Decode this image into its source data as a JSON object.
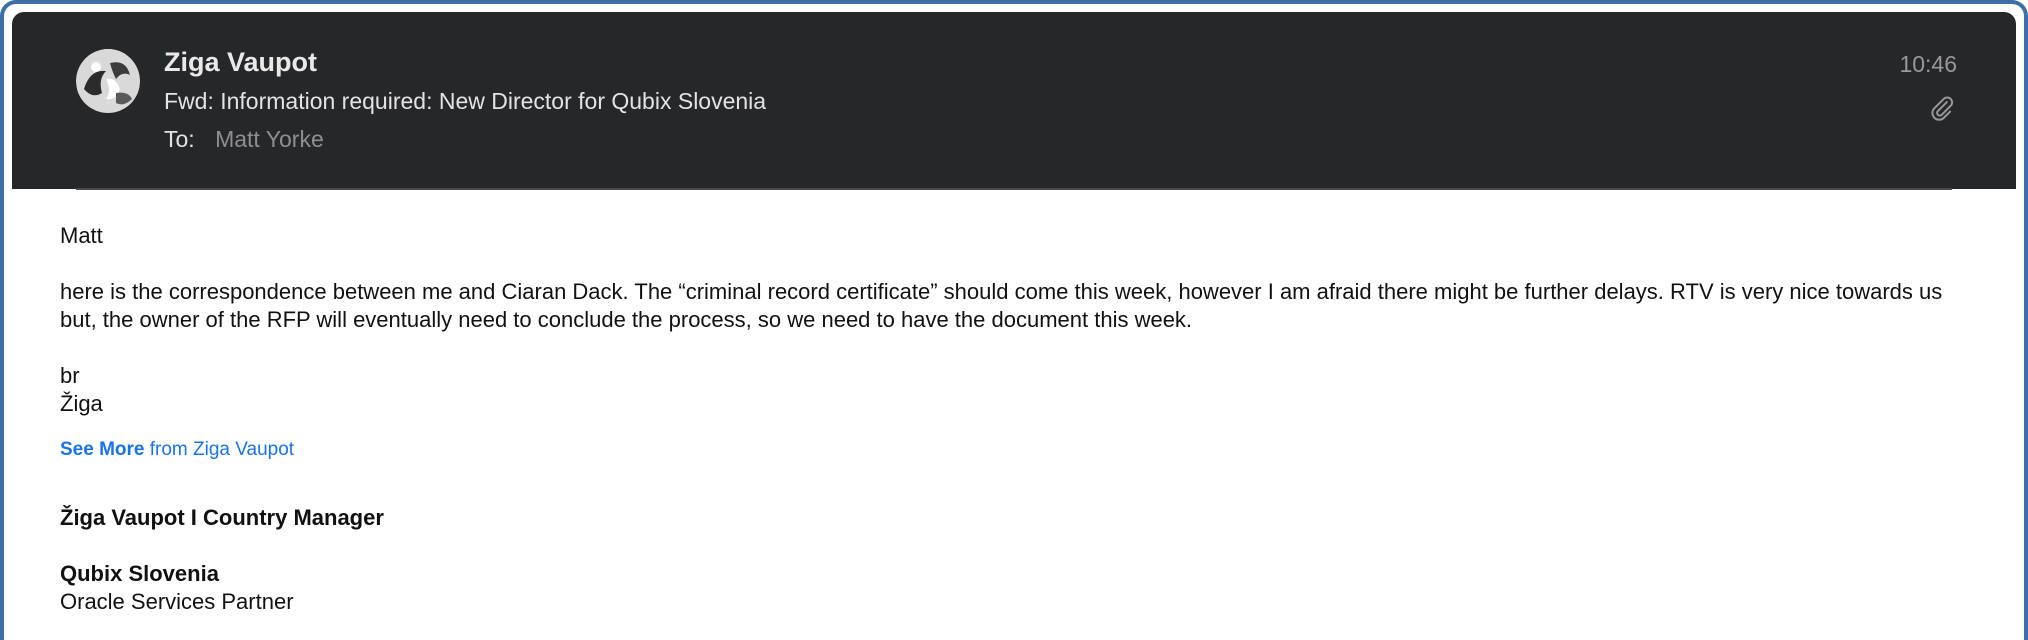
{
  "header": {
    "sender_name": "Ziga Vaupot",
    "subject": "Fwd: Information required: New Director for Qubix Slovenia",
    "to_label": "To:",
    "to_value": "Matt Yorke",
    "time": "10:46",
    "avatar_icon": "avatar-image",
    "attachment_icon": "paperclip-icon"
  },
  "body": {
    "greeting": "Matt",
    "paragraph": "here is the correspondence between me and Ciaran Dack. The “criminal record certificate” should come this week, however I am afraid there might be further delays. RTV is very nice towards us but, the owner of the RFP will eventually need to conclude the process, so we need to have the document this week.",
    "signoff_1": "br",
    "signoff_2": "Žiga",
    "see_more_bold": "See More",
    "see_more_rest": " from Ziga Vaupot",
    "sig_name": "Žiga Vaupot  I Country Manager",
    "sig_company": "Qubix Slovenia",
    "sig_partner": "Oracle Services Partner"
  },
  "colors": {
    "header_bg": "#262729",
    "frame_border": "#3a6fa8",
    "link": "#1a73e8"
  }
}
